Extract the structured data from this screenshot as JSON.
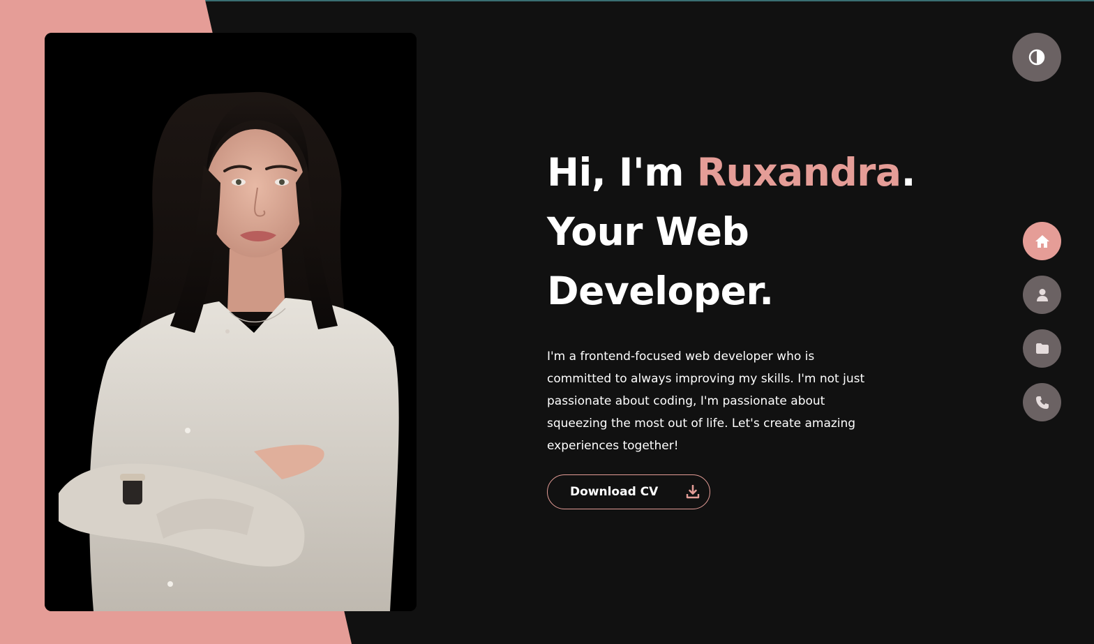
{
  "hero": {
    "greeting": "Hi, I'm ",
    "name": "Ruxandra",
    "period": ".",
    "line2": "Your Web",
    "line3": "Developer.",
    "description": "I'm a frontend-focused web developer who is committed to always improving my skills. I'm not just passionate about coding, I'm passionate about squeezing the most out of life. Let's create amazing experiences together!",
    "cv_button_label": "Download CV",
    "cv_icon": "download-icon"
  },
  "theme_toggle": {
    "icon": "contrast-icon"
  },
  "side_nav": {
    "items": [
      {
        "icon": "home-icon",
        "active": true
      },
      {
        "icon": "user-icon",
        "active": false
      },
      {
        "icon": "folder-icon",
        "active": false
      },
      {
        "icon": "phone-icon",
        "active": false
      }
    ]
  },
  "colors": {
    "accent": "#e59d97",
    "background": "#111111",
    "button_gray": "#6b6263",
    "text": "#ffffff"
  }
}
